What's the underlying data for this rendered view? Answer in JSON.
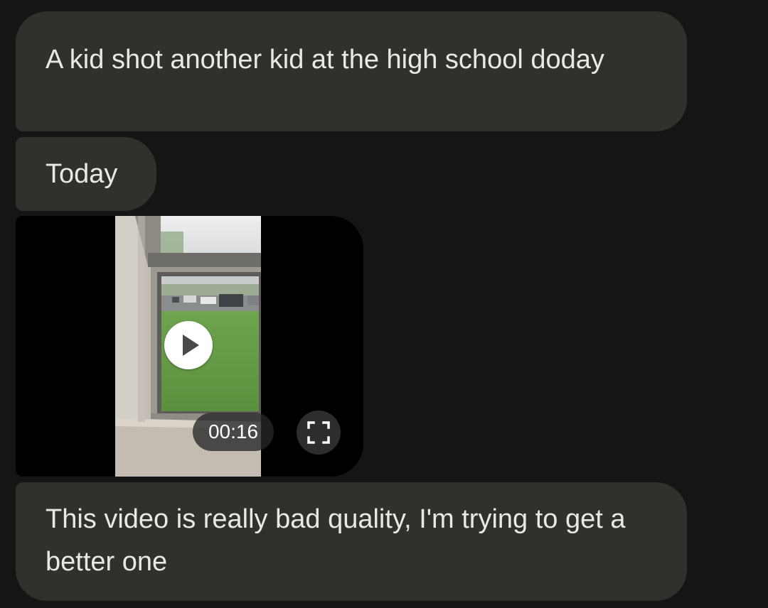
{
  "messages": [
    {
      "text": "A kid shot another kid at the high school doday"
    },
    {
      "text": "Today"
    },
    {
      "video": {
        "duration": "00:16",
        "play_icon": "play-icon",
        "fullscreen_icon": "fullscreen-icon"
      }
    },
    {
      "text": "This video is really bad quality, I'm trying to get a better one"
    }
  ],
  "colors": {
    "background": "#151613",
    "bubble": "#30312d",
    "text": "#e8e8e4",
    "video_background": "#000000"
  }
}
